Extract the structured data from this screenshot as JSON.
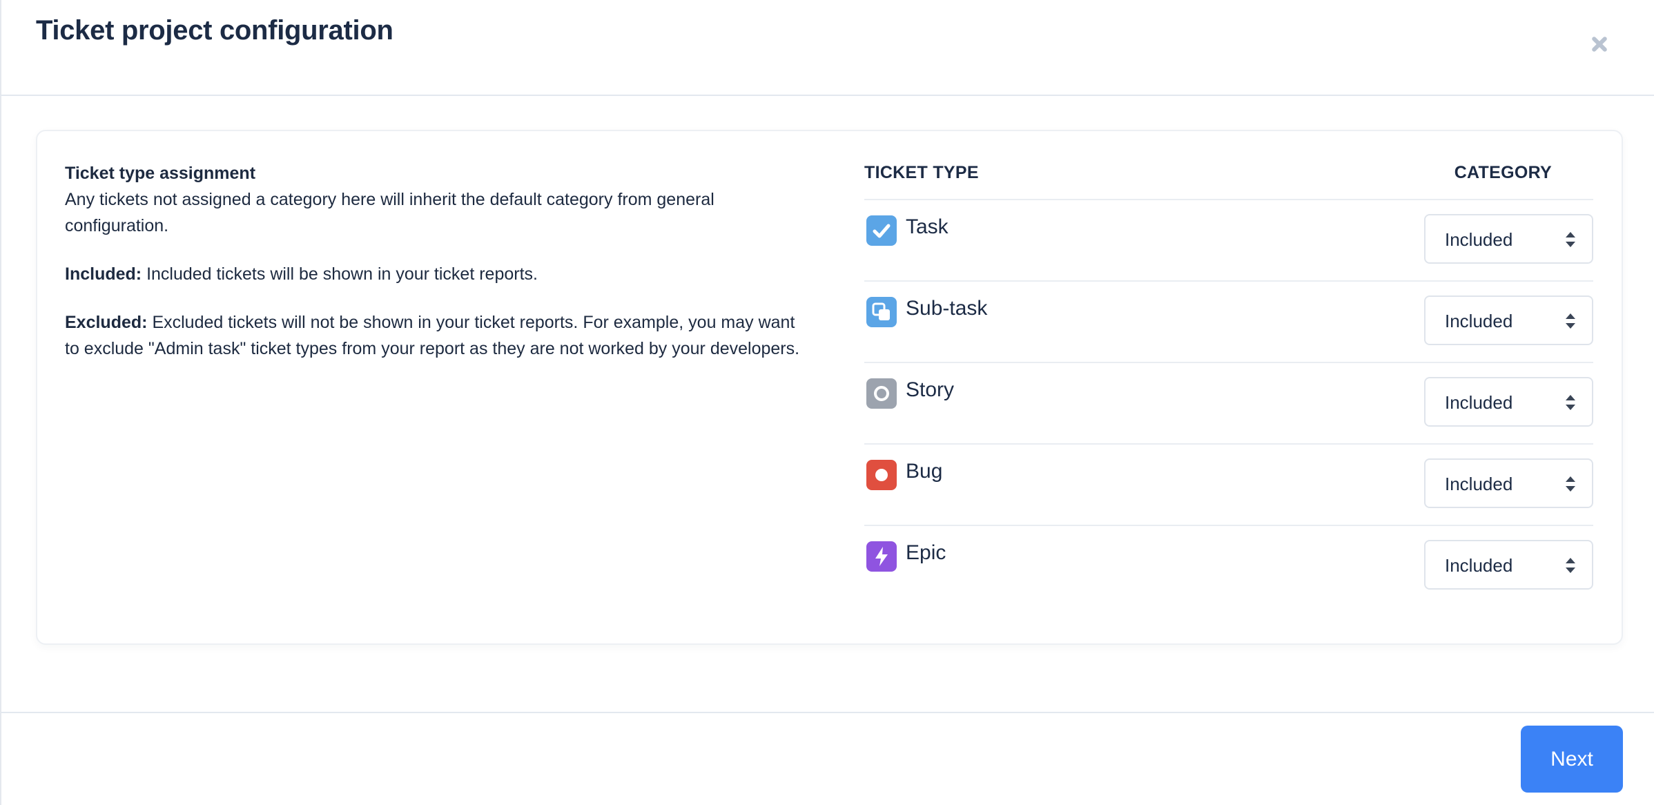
{
  "modal": {
    "title": "Ticket project configuration"
  },
  "info": {
    "heading": "Ticket type assignment",
    "description": "Any tickets not assigned a category here will inherit the default category from general configuration.",
    "included_label": "Included:",
    "included_text": "Included tickets will be shown in your ticket reports.",
    "excluded_label": "Excluded:",
    "excluded_text": "Excluded tickets will not be shown in your ticket reports. For example, you may want to exclude \"Admin task\" ticket types from your report as they are not worked by your developers."
  },
  "table": {
    "col_type": "TICKET TYPE",
    "col_category": "CATEGORY",
    "rows": [
      {
        "type": "Task",
        "icon": "task-icon",
        "color": "#5ba5e6",
        "category": "Included"
      },
      {
        "type": "Sub-task",
        "icon": "subtask-icon",
        "color": "#5ba5e6",
        "category": "Included"
      },
      {
        "type": "Story",
        "icon": "story-icon",
        "color": "#9ca3ae",
        "category": "Included"
      },
      {
        "type": "Bug",
        "icon": "bug-icon",
        "color": "#e04f3f",
        "category": "Included"
      },
      {
        "type": "Epic",
        "icon": "epic-icon",
        "color": "#8f54e0",
        "category": "Included"
      }
    ]
  },
  "footer": {
    "next_label": "Next"
  },
  "colors": {
    "primary": "#3b82f6",
    "text": "#1c2b45",
    "border": "#e3e8ef"
  }
}
